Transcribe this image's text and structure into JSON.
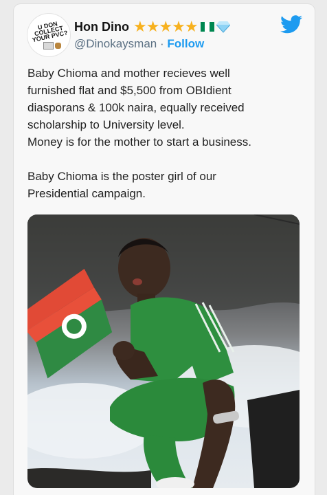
{
  "author": {
    "name": "Hon Dino",
    "handle": "@Dinokaysman",
    "separator": "·",
    "follow_label": "Follow",
    "avatar_text": "U DON\nCOLLECT\nYOUR PVC?",
    "badges": [
      "star-icon",
      "star-icon",
      "star-icon",
      "star-icon",
      "star-icon",
      "nigeria-flag-icon",
      "gem-icon"
    ]
  },
  "platform_icon": "twitter-bird-icon",
  "tweet": {
    "paragraph1": "Baby Chioma and mother recieves well\nfurnished flat and $5,500 from OBIdient\ndiasporans & 100k naira, equally received\nscholarship to University level.\nMoney is for the mother to start a business.",
    "paragraph2": "Baby Chioma is the poster girl of our\nPresidential campaign."
  },
  "colors": {
    "twitter_blue": "#1d9bf0",
    "star_gold": "#f7b11e",
    "handle_gray": "#5b7083",
    "flag_green": "#008751",
    "jersey_green": "#2e8f3f"
  }
}
